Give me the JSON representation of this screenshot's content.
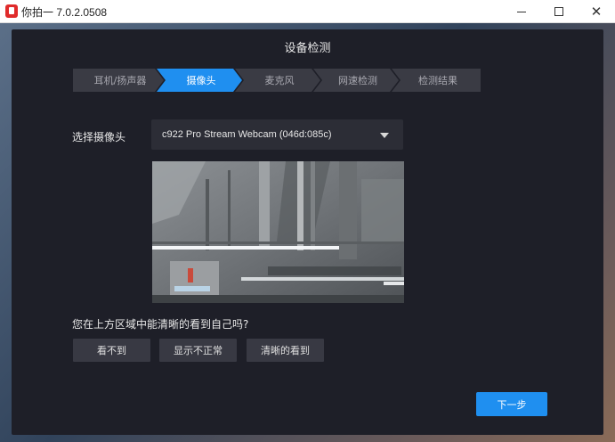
{
  "window": {
    "title": "你拍一 7.0.2.0508",
    "minimize": "minimize",
    "maximize": "maximize",
    "close": "✕"
  },
  "dialog": {
    "title": "设备检测",
    "steps": [
      {
        "label": "耳机/扬声器",
        "active": false
      },
      {
        "label": "摄像头",
        "active": true
      },
      {
        "label": "麦克风",
        "active": false
      },
      {
        "label": "网速检测",
        "active": false
      },
      {
        "label": "检测结果",
        "active": false
      }
    ],
    "camera_label": "选择摄像头",
    "camera_selected": "c922 Pro Stream Webcam (046d:085c)",
    "question": "您在上方区域中能清晰的看到自己吗?",
    "choices": [
      "看不到",
      "显示不正常",
      "清晰的看到"
    ],
    "next": "下一步"
  },
  "colors": {
    "accent": "#1f8ff0",
    "dialog_bg": "#1e1f28",
    "step_bg": "#3a3b44"
  }
}
